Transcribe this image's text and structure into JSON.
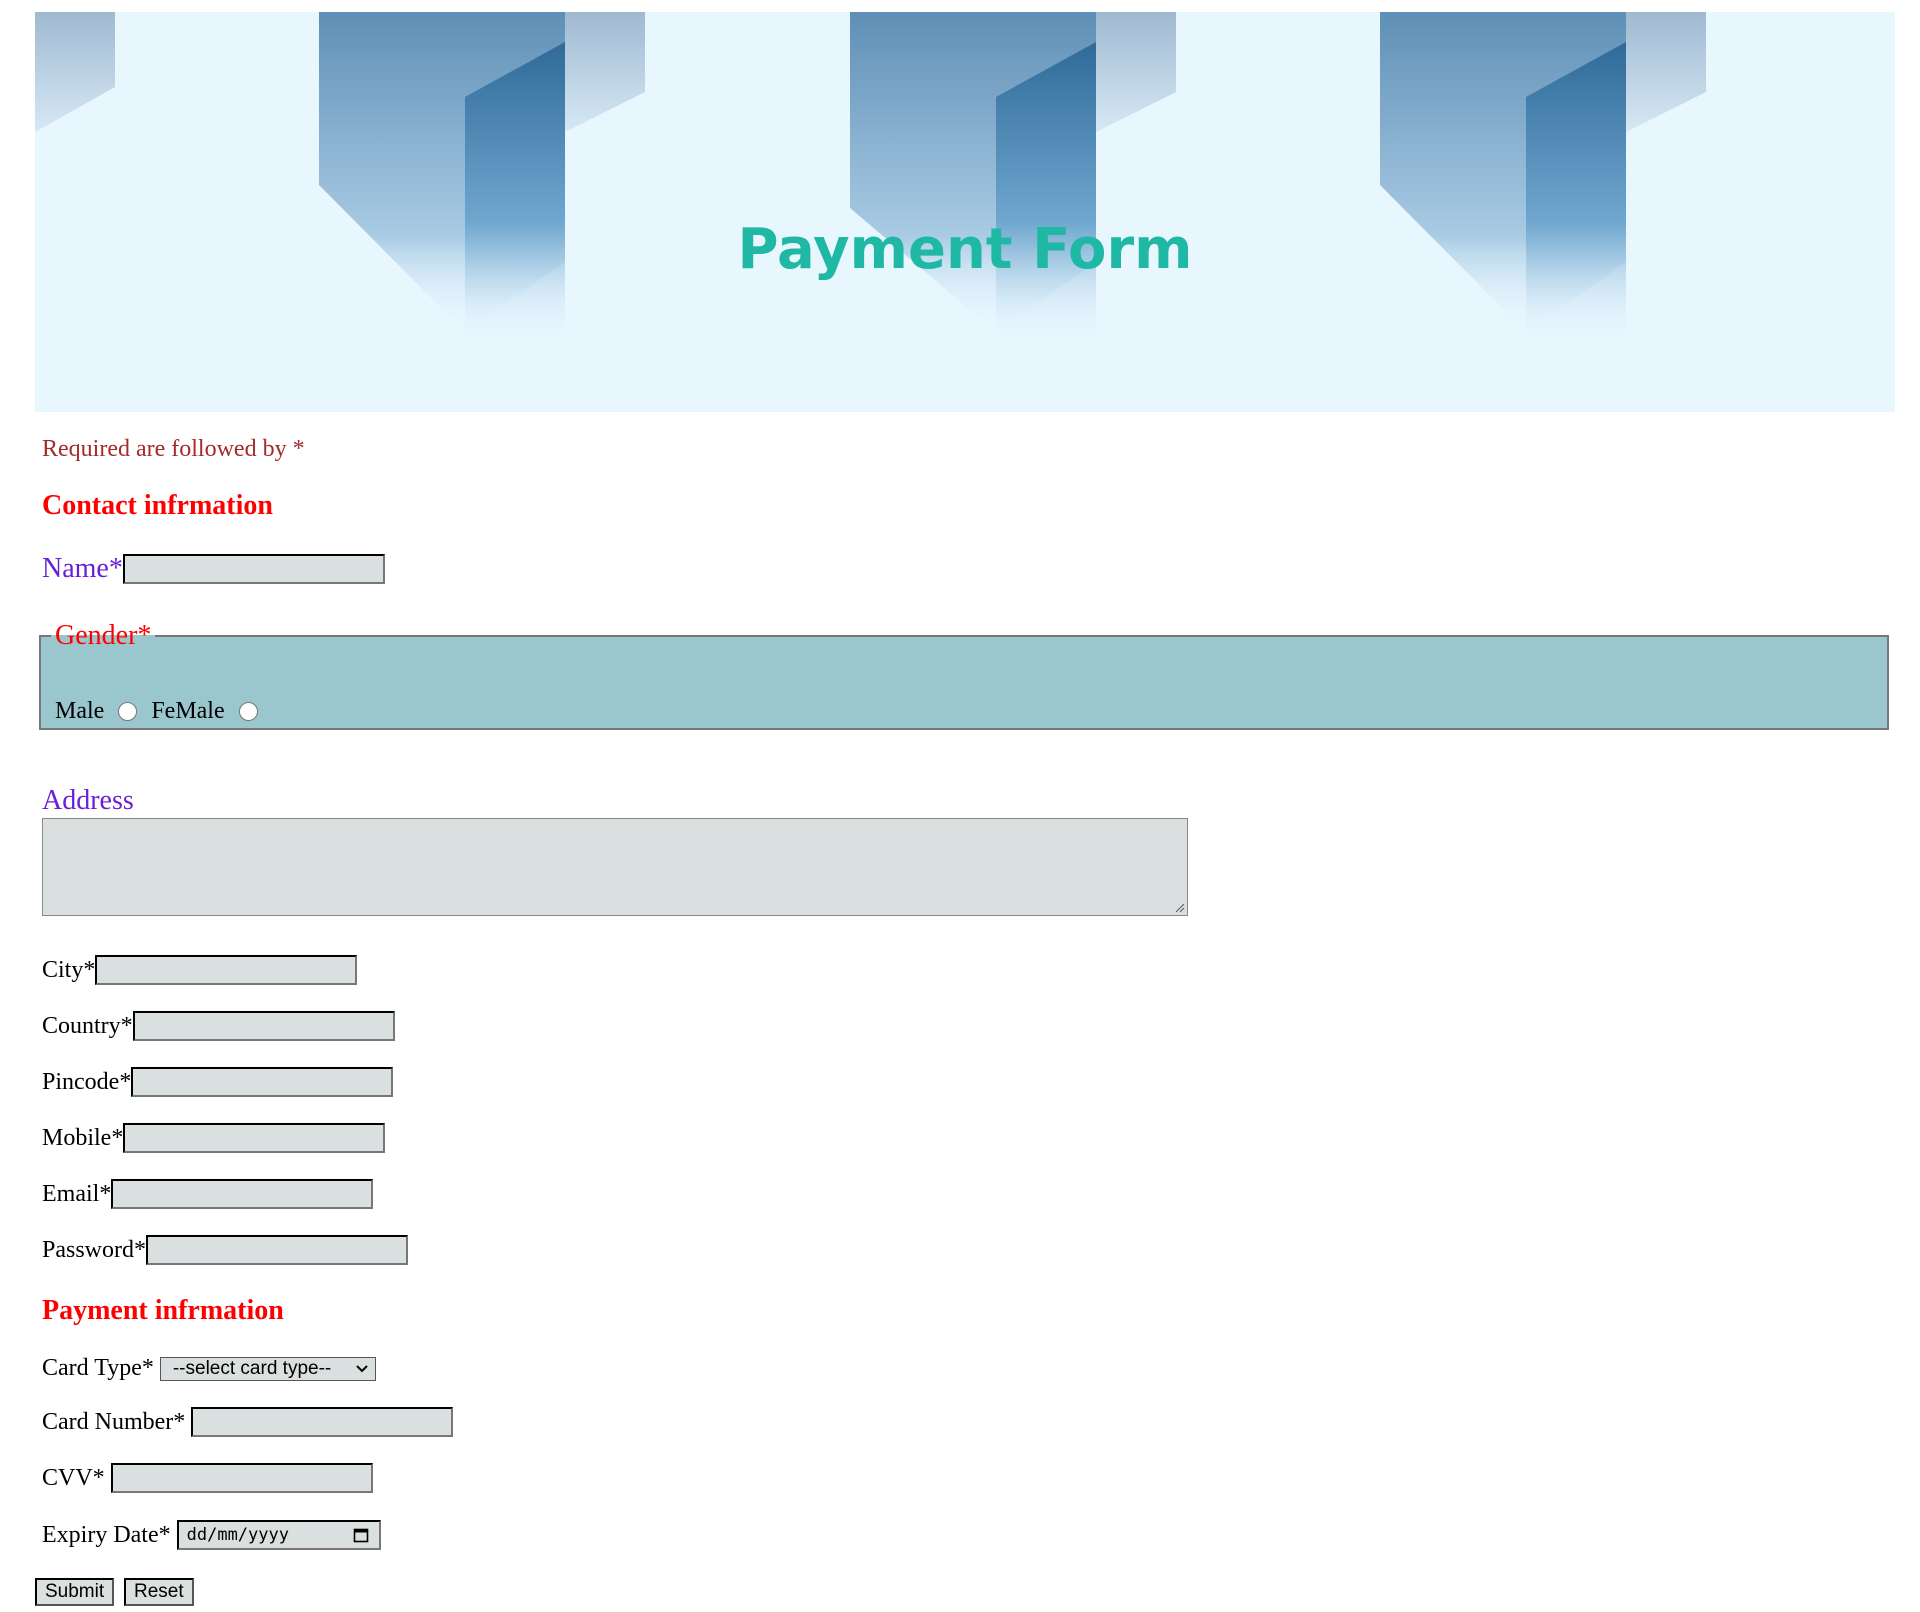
{
  "header": {
    "title": "Payment Form"
  },
  "required_note": "Required are followed by *",
  "contact_section": {
    "heading": "Contact infrmation"
  },
  "name_field": {
    "label": "Name*",
    "value": ""
  },
  "gender": {
    "legend": "Gender*",
    "options": [
      {
        "label": "Male",
        "selected": false
      },
      {
        "label": "FeMale",
        "selected": false
      }
    ]
  },
  "address": {
    "label": "Address",
    "value": ""
  },
  "fields": [
    {
      "label": "City*",
      "value": ""
    },
    {
      "label": "Country*",
      "value": ""
    },
    {
      "label": "Pincode*",
      "value": ""
    },
    {
      "label": "Mobile*",
      "value": ""
    },
    {
      "label": "Email*",
      "value": ""
    },
    {
      "label": "Password*",
      "value": ""
    }
  ],
  "payment_section": {
    "heading": "Payment infrmation"
  },
  "card_type": {
    "label": "Card Type*",
    "selected": "--select card type--"
  },
  "card_number": {
    "label": "Card Number*",
    "value": ""
  },
  "cvv": {
    "label": "CVV*",
    "value": ""
  },
  "expiry": {
    "label": "Expiry Date*",
    "placeholder": "dd/mm/yyyy"
  },
  "buttons": {
    "submit": "Submit",
    "reset": "Reset"
  },
  "colors": {
    "title": "#1fb8a4",
    "heading_red": "#ff0000",
    "purple_label": "#6a1fd6",
    "required_note": "#a52a2a",
    "field_bg": "#d9e0df",
    "gender_bg": "#9ac7ce",
    "header_bg": "#e8f6fe"
  }
}
